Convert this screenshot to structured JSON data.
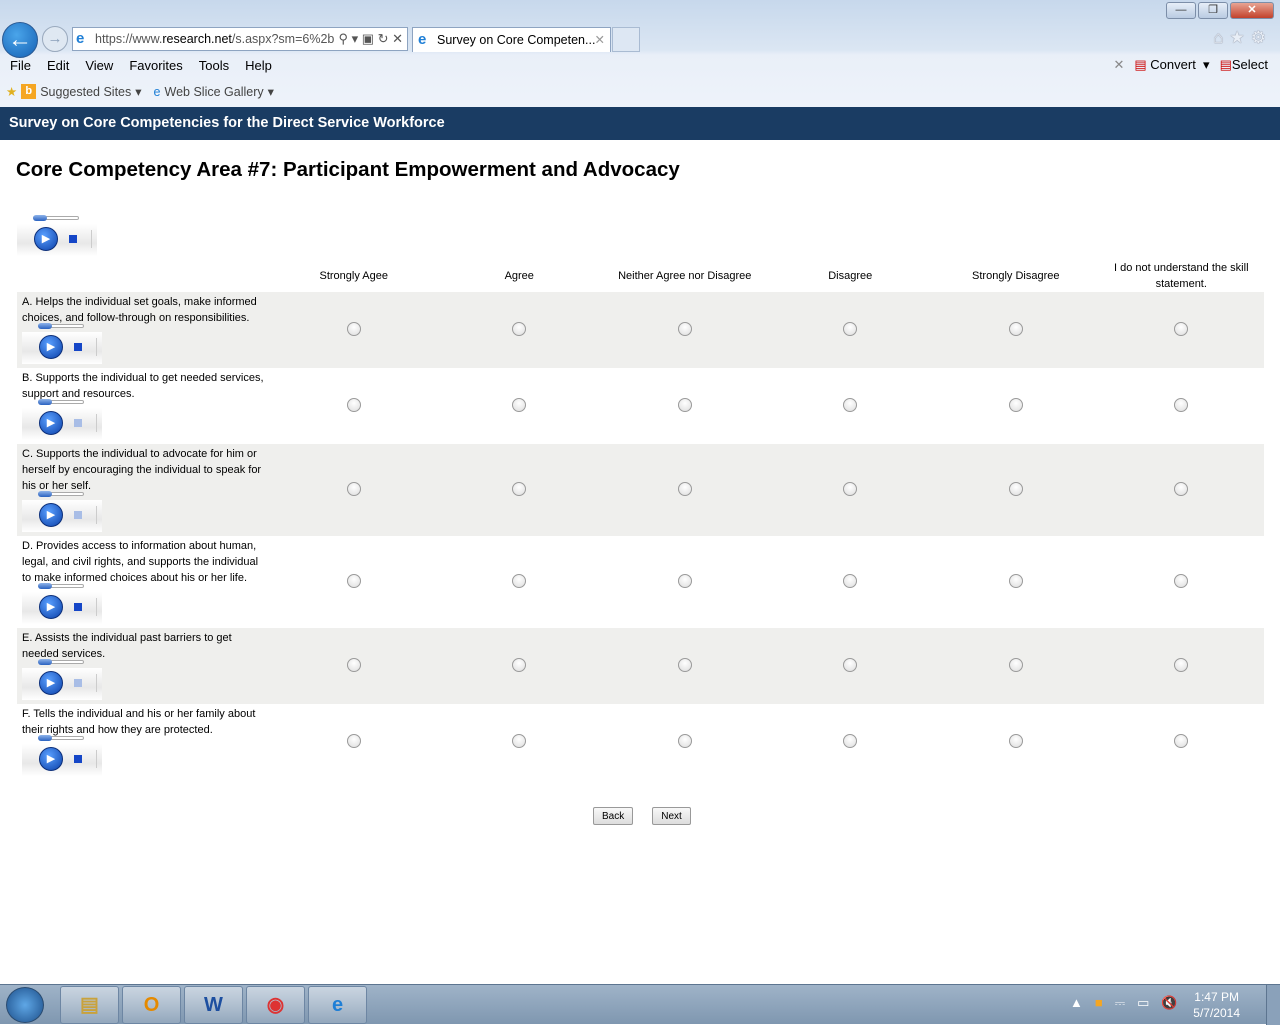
{
  "browser": {
    "url_prefix": "https://www.",
    "url_domain": "research.net",
    "url_path": "/s.aspx?sm=6%2b",
    "tab_title": "Survey on Core Competen...",
    "menu": [
      "File",
      "Edit",
      "View",
      "Favorites",
      "Tools",
      "Help"
    ],
    "convert_label": "Convert",
    "select_label": "Select",
    "favorites": [
      "Suggested Sites",
      "Web Slice Gallery"
    ]
  },
  "page": {
    "banner": "Survey on Core Competencies for the Direct Service Workforce",
    "title": "Core Competency Area #7: Participant Empowerment and Advocacy"
  },
  "columns": [
    "Strongly Agee",
    "Agree",
    "Neither Agree nor Disagree",
    "Disagree",
    "Strongly Disagree",
    "I do not understand the skill statement."
  ],
  "questions": [
    {
      "text": "A. Helps the individual set goals, make informed choices, and follow-through on responsibilities."
    },
    {
      "text": "B. Supports the individual to get needed services, support and resources."
    },
    {
      "text": "C. Supports the individual to advocate for him or herself by encouraging the individual to speak for his or her self."
    },
    {
      "text": "D. Provides access to information about human, legal, and civil rights, and supports the individual to make informed choices about his or her life."
    },
    {
      "text": "E. Assists the individual past barriers to get needed services."
    },
    {
      "text": "F. Tells the individual and his or her family about their rights and how they are protected."
    }
  ],
  "nav": {
    "back": "Back",
    "next": "Next"
  },
  "taskbar": {
    "time": "1:47 PM",
    "date": "5/7/2014"
  }
}
